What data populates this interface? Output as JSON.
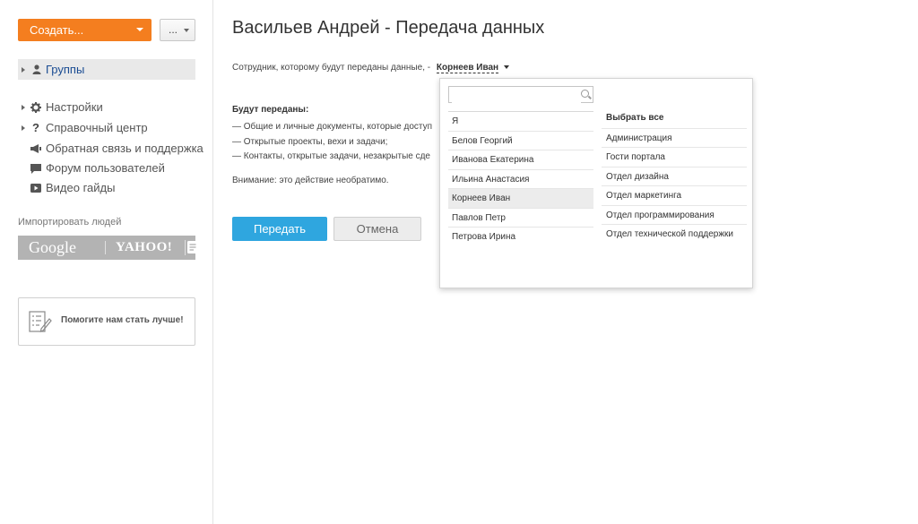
{
  "sidebar": {
    "create_label": "Создать...",
    "more_label": "...",
    "groups_label": "Группы",
    "items": [
      {
        "label": "Настройки"
      },
      {
        "label": "Справочный центр"
      },
      {
        "label": "Обратная связь и поддержка"
      },
      {
        "label": "Форум пользователей"
      },
      {
        "label": "Видео гайды"
      }
    ],
    "import_label": "Импортировать людей",
    "import_google": "Google",
    "import_yahoo": "YAHOO!",
    "help_label": "Помогите нам стать лучше!"
  },
  "main": {
    "title": "Васильев Андрей - Передача данных",
    "employee_prefix": "Сотрудник, которому будут переданы данные, -",
    "employee_selected": "Корнеев Иван",
    "will_transfer": "Будут переданы:",
    "bullets": [
      "—  Общие и личные документы, которые доступ",
      "—  Открытые проекты, вехи и задачи;",
      "—  Контакты, открытые задачи, незакрытые сде"
    ],
    "warning": "Внимание: это действие необратимо.",
    "transfer_button": "Передать",
    "cancel_button": "Отмена"
  },
  "dropdown": {
    "search_placeholder": "",
    "people": [
      "Я",
      "Белов Георгий",
      "Иванова Екатерина",
      "Ильина Анастасия",
      "Корнеев Иван",
      "Павлов Петр",
      "Петрова Ирина"
    ],
    "select_all": "Выбрать все",
    "groups": [
      "Администрация",
      "Гости портала",
      "Отдел дизайна",
      "Отдел маркетинга",
      "Отдел программирования",
      "Отдел технической поддержки"
    ]
  },
  "colors": {
    "accent_orange": "#f47e1f",
    "primary_blue": "#2fa6df",
    "link_blue": "#1a4c93"
  }
}
